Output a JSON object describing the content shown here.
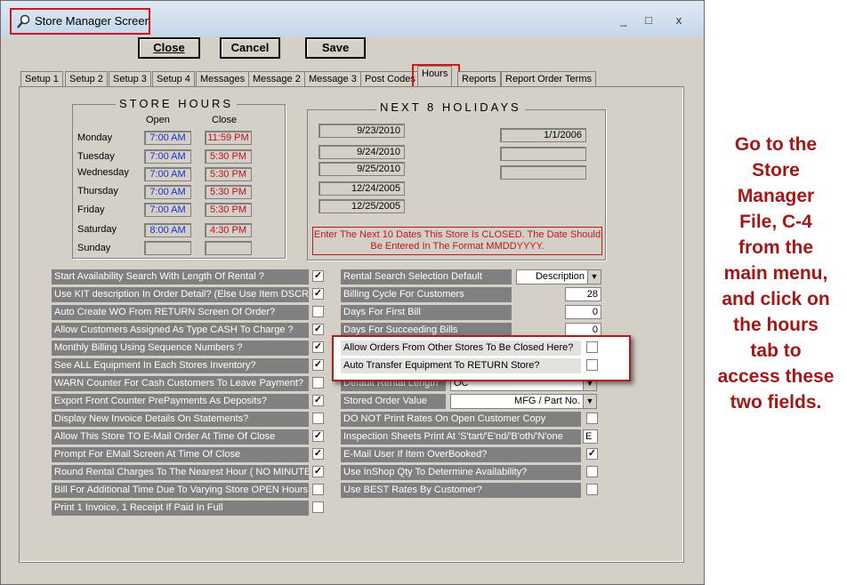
{
  "window": {
    "title": "Store Manager Screen",
    "min": "_",
    "max": "□",
    "close": "x"
  },
  "toolbar": {
    "close": "Close",
    "cancel": "Cancel",
    "save": "Save"
  },
  "tabs": [
    "Setup 1",
    "Setup 2",
    "Setup 3",
    "Setup 4",
    "Messages",
    "Message 2",
    "Message 3",
    "Post Codes",
    "Hours",
    "Reports",
    "Report Order Terms"
  ],
  "active_tab": "Hours",
  "store_hours": {
    "title": "STORE HOURS",
    "open_header": "Open",
    "close_header": "Close",
    "days": [
      {
        "day": "Monday",
        "open": "7:00 AM",
        "close": "11:59 PM"
      },
      {
        "day": "Tuesday",
        "open": "7:00 AM",
        "close": "5:30 PM"
      },
      {
        "day": "Wednesday",
        "open": "7:00 AM",
        "close": "5:30 PM"
      },
      {
        "day": "Thursday",
        "open": "7:00 AM",
        "close": "5:30 PM"
      },
      {
        "day": "Friday",
        "open": "7:00 AM",
        "close": "5:30 PM"
      },
      {
        "day": "Saturday",
        "open": "8:00 AM",
        "close": "4:30 PM"
      },
      {
        "day": "Sunday",
        "open": "",
        "close": ""
      }
    ]
  },
  "holidays": {
    "title": "NEXT 8 HOLIDAYS",
    "left": [
      "9/23/2010",
      "9/24/2010",
      "9/25/2010",
      "12/24/2005",
      "12/25/2005"
    ],
    "right": [
      "1/1/2006",
      "",
      ""
    ],
    "note": "Enter The Next 10 Dates This Store Is CLOSED. The Date Should Be Entered In The Format MMDDYYYY."
  },
  "left_options": [
    {
      "label": "Start Availability Search With Length Of Rental ?",
      "checked": true
    },
    {
      "label": "Use KIT description In Order Detail? (Else Use Item DSCR)",
      "checked": true
    },
    {
      "label": "Auto Create WO From RETURN Screen Of Order?",
      "checked": false
    },
    {
      "label": "Allow Customers Assigned As Type CASH To Charge ?",
      "checked": true
    },
    {
      "label": "Monthly Billing Using Sequence Numbers ?",
      "checked": true
    },
    {
      "label": "See ALL Equipment In Each Stores Inventory?",
      "checked": true
    },
    {
      "label": "WARN Counter For Cash Customers To Leave Payment?",
      "checked": false
    },
    {
      "label": "Export Front Counter PrePayments As Deposits?",
      "checked": true
    },
    {
      "label": "Display New Invoice Details On Statements?",
      "checked": false
    },
    {
      "label": "Allow This Store TO E-Mail Order At Time Of Close",
      "checked": true
    },
    {
      "label": "Prompt For EMail Screen At Time Of Close",
      "checked": true
    },
    {
      "label": "Round Rental Charges To The Nearest Hour ( NO MINUTE)",
      "checked": true
    },
    {
      "label": "Bill For Additional Time Due To Varying Store OPEN Hours",
      "checked": false
    },
    {
      "label": "Print 1 Invoice, 1 Receipt If Paid In Full",
      "checked": false
    }
  ],
  "right_options": {
    "rental_search": {
      "label": "Rental Search Selection Default",
      "value": "Description"
    },
    "billing_cycle": {
      "label": "Billing Cycle For Customers",
      "value": "28"
    },
    "days_first": {
      "label": "Days For First Bill",
      "value": "0"
    },
    "days_succeeding": {
      "label": "Days For Succeeding Bills",
      "value": "0"
    },
    "allow_orders": {
      "label": "Allow Orders  From Other Stores To Be Closed Here?",
      "checked": false
    },
    "auto_transfer": {
      "label": "Auto Transfer Equipment To RETURN Store?",
      "checked": false
    },
    "default_rental": {
      "label": "Default Rental Length",
      "value": "OC"
    },
    "stored_order": {
      "label": "Stored Order Value",
      "value": "MFG / Part No."
    },
    "do_not_print": {
      "label": "DO NOT Print Rates On Open Customer Copy",
      "checked": false
    },
    "inspection": {
      "label": "Inspection Sheets Print At 'S'tart/'E'nd/'B'oth/'N'one",
      "value": "E"
    },
    "email_user": {
      "label": "E-Mail User If Item OverBooked?",
      "checked": true
    },
    "inshop": {
      "label": "Use InShop Qty To Determine Availability?",
      "checked": false
    },
    "best_rates": {
      "label": "Use BEST Rates By Customer?",
      "checked": false
    }
  },
  "side_note": "Go to the Store Manager File, C-4 from the main menu, and click on the hours tab to access these two fields."
}
